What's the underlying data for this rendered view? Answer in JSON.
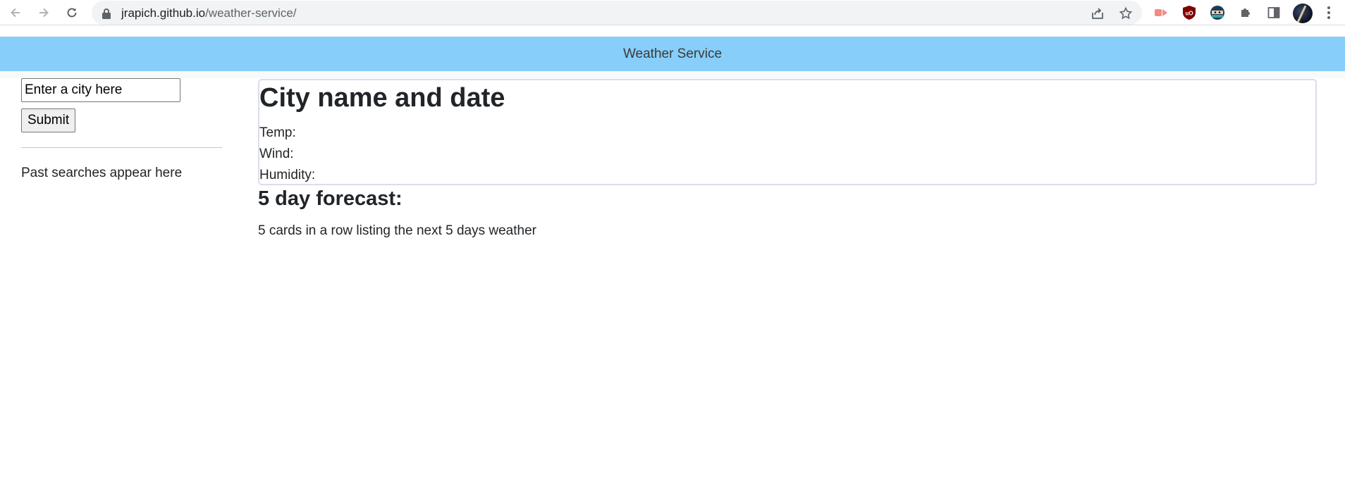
{
  "browser": {
    "url_host": "jrapich.github.io",
    "url_path": "/weather-service/",
    "icons": [
      "back-arrow-icon",
      "forward-arrow-icon",
      "reload-icon",
      "lock-icon",
      "share-icon",
      "star-icon",
      "extension-icon",
      "ublock-icon",
      "ninja-extension-icon",
      "puzzle-icon",
      "side-panel-icon",
      "profile-avatar",
      "kebab-menu-icon"
    ]
  },
  "header": {
    "title": "Weather Service",
    "background": "#87cefa"
  },
  "sidebar": {
    "search_placeholder": "Enter a city here",
    "submit_label": "Submit",
    "past_searches_text": "Past searches appear here"
  },
  "current": {
    "heading": "City name and date",
    "temp_label": "Temp:",
    "wind_label": "Wind:",
    "humidity_label": "Humidity:"
  },
  "forecast": {
    "heading": "5 day forecast:",
    "description": "5 cards in a row listing the next 5 days weather"
  }
}
